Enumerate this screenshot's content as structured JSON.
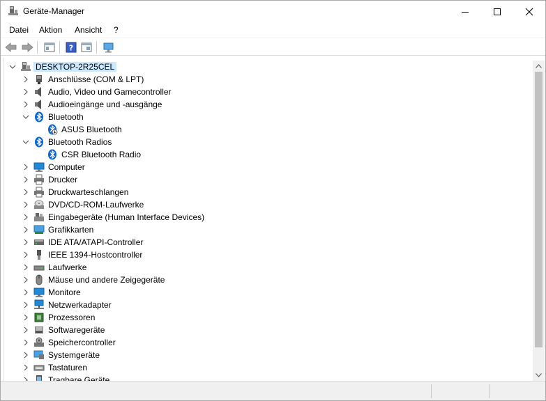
{
  "window": {
    "title": "Geräte-Manager"
  },
  "menu": [
    "Datei",
    "Aktion",
    "Ansicht",
    "?"
  ],
  "tree": {
    "root": "DESKTOP-2R25CEL",
    "items": [
      {
        "label": "Anschlüsse (COM & LPT)",
        "icon": "port-icon",
        "expanded": false
      },
      {
        "label": "Audio, Video und Gamecontroller",
        "icon": "speaker-icon",
        "expanded": false
      },
      {
        "label": "Audioeingänge und -ausgänge",
        "icon": "speaker-icon",
        "expanded": false
      },
      {
        "label": "Bluetooth",
        "icon": "bluetooth-icon",
        "expanded": true,
        "children": [
          {
            "label": "ASUS Bluetooth",
            "icon": "bluetooth-device-icon"
          }
        ]
      },
      {
        "label": "Bluetooth Radios",
        "icon": "bluetooth-icon",
        "expanded": true,
        "children": [
          {
            "label": "CSR Bluetooth Radio",
            "icon": "bluetooth-icon"
          }
        ]
      },
      {
        "label": "Computer",
        "icon": "computer-icon",
        "expanded": false
      },
      {
        "label": "Drucker",
        "icon": "printer-icon",
        "expanded": false
      },
      {
        "label": "Druckwarteschlangen",
        "icon": "printer-icon",
        "expanded": false
      },
      {
        "label": "DVD/CD-ROM-Laufwerke",
        "icon": "disc-icon",
        "expanded": false
      },
      {
        "label": "Eingabegeräte (Human Interface Devices)",
        "icon": "hid-icon",
        "expanded": false
      },
      {
        "label": "Grafikkarten",
        "icon": "display-adapter-icon",
        "expanded": false
      },
      {
        "label": "IDE ATA/ATAPI-Controller",
        "icon": "ide-icon",
        "expanded": false
      },
      {
        "label": "IEEE 1394-Hostcontroller",
        "icon": "firewire-icon",
        "expanded": false
      },
      {
        "label": "Laufwerke",
        "icon": "drive-icon",
        "expanded": false
      },
      {
        "label": "Mäuse und andere Zeigegeräte",
        "icon": "mouse-icon",
        "expanded": false
      },
      {
        "label": "Monitore",
        "icon": "monitor-icon",
        "expanded": false
      },
      {
        "label": "Netzwerkadapter",
        "icon": "network-icon",
        "expanded": false
      },
      {
        "label": "Prozessoren",
        "icon": "cpu-icon",
        "expanded": false
      },
      {
        "label": "Softwaregeräte",
        "icon": "software-device-icon",
        "expanded": false
      },
      {
        "label": "Speichercontroller",
        "icon": "storage-controller-icon",
        "expanded": false
      },
      {
        "label": "Systemgeräte",
        "icon": "system-device-icon",
        "expanded": false
      },
      {
        "label": "Tastaturen",
        "icon": "keyboard-icon",
        "expanded": false
      },
      {
        "label": "Tragbare Geräte",
        "icon": "portable-device-icon",
        "expanded": false
      }
    ]
  },
  "colors": {
    "selection": "#cce8ff",
    "bluetooth": "#0a64d6",
    "monitor": "#1e8ad8"
  }
}
